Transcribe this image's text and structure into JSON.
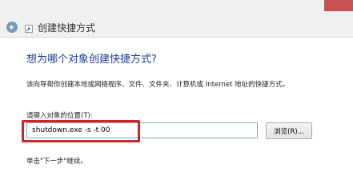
{
  "window": {
    "title": "创建快捷方式",
    "back_icon": "back-arrow-icon",
    "wizard_icon": "shortcut-wizard-icon"
  },
  "content": {
    "heading": "想为哪个对象创建快捷方式?",
    "description": "该向导帮你创建本地或网络程序、文件、文件夹、计算机或 Internet 地址的快捷方式。",
    "location_label": "请键入对象的位置(T):",
    "location_value": "shutdown.exe -s -t 00",
    "browse_label": "浏览(R)...",
    "hint": "单击\"下一步\"继续。"
  },
  "colors": {
    "heading": "#1e3c96",
    "highlight": "#c8262a",
    "back_button": "#7a9bbb"
  }
}
